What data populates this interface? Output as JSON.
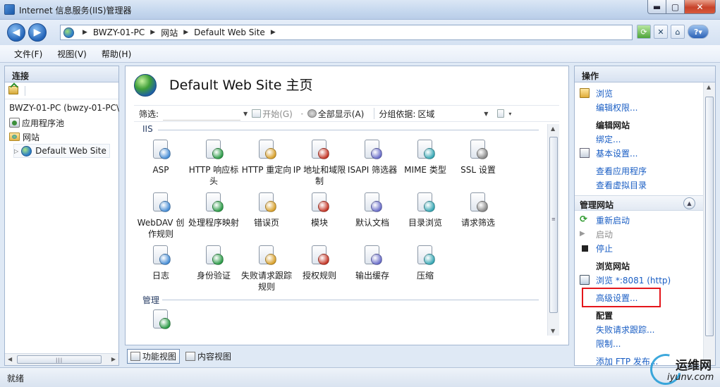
{
  "window": {
    "title": "Internet 信息服务(IIS)管理器",
    "controls": {
      "minimize": "▬",
      "maximize": "▢",
      "close": "✕"
    }
  },
  "address_bar": {
    "crumbs": [
      "BWZY-01-PC",
      "网站",
      "Default Web Site"
    ],
    "separator": "▶"
  },
  "menu": [
    "文件(F)",
    "视图(V)",
    "帮助(H)"
  ],
  "connections": {
    "header": "连接",
    "tree": {
      "root": "BWZY-01-PC (bwzy-01-PC\\",
      "app_pools": "应用程序池",
      "sites": "网站",
      "site": "Default Web Site"
    }
  },
  "center": {
    "title": "Default Web Site 主页",
    "filter": {
      "label": "筛选:",
      "value": "",
      "go_label": "开始(G)",
      "show_all_label": "全部显示(A)",
      "group_label": "分组依据:",
      "group_value": "区域"
    },
    "groups": [
      {
        "name": "IIS",
        "features": [
          {
            "label": "ASP",
            "icon": "asp-icon"
          },
          {
            "label": "HTTP 响应标头",
            "icon": "http-response-headers-icon"
          },
          {
            "label": "HTTP 重定向",
            "icon": "http-redirect-icon"
          },
          {
            "label": "IP 地址和域限制",
            "icon": "ip-domain-restrictions-icon"
          },
          {
            "label": "ISAPI 筛选器",
            "icon": "isapi-filters-icon"
          },
          {
            "label": "MIME 类型",
            "icon": "mime-types-icon"
          },
          {
            "label": "SSL 设置",
            "icon": "ssl-settings-icon"
          },
          {
            "label": "WebDAV 创作规则",
            "icon": "webdav-icon"
          },
          {
            "label": "处理程序映射",
            "icon": "handler-mappings-icon"
          },
          {
            "label": "错误页",
            "icon": "error-pages-icon"
          },
          {
            "label": "模块",
            "icon": "modules-icon"
          },
          {
            "label": "默认文档",
            "icon": "default-document-icon"
          },
          {
            "label": "目录浏览",
            "icon": "directory-browsing-icon"
          },
          {
            "label": "请求筛选",
            "icon": "request-filtering-icon"
          },
          {
            "label": "日志",
            "icon": "logging-icon"
          },
          {
            "label": "身份验证",
            "icon": "authentication-icon"
          },
          {
            "label": "失败请求跟踪规则",
            "icon": "failed-request-tracing-icon"
          },
          {
            "label": "授权规则",
            "icon": "authorization-rules-icon"
          },
          {
            "label": "输出缓存",
            "icon": "output-caching-icon"
          },
          {
            "label": "压缩",
            "icon": "compression-icon"
          }
        ]
      },
      {
        "name": "管理",
        "features": [
          {
            "label": "",
            "icon": "configuration-editor-icon"
          }
        ]
      }
    ],
    "view_tabs": {
      "features": "功能视图",
      "content": "内容视图"
    }
  },
  "actions": {
    "header": "操作",
    "explore": "浏览",
    "edit_permissions": "编辑权限...",
    "edit_site_header": "编辑网站",
    "bindings": "绑定...",
    "basic_settings": "基本设置...",
    "view_applications": "查看应用程序",
    "view_virtual_dirs": "查看虚拟目录",
    "manage_site_header": "管理网站",
    "restart": "重新启动",
    "start": "启动",
    "stop": "停止",
    "browse_site_header": "浏览网站",
    "browse_link": "浏览 *:8081 (http)",
    "advanced_settings": "高级设置...",
    "configure_header": "配置",
    "failed_request_tracing": "失败请求跟踪...",
    "limits": "限制...",
    "add_ftp": "添加 FTP 发布..."
  },
  "status": {
    "text": "就绪"
  },
  "watermark": {
    "cn": "运维网",
    "en": "iyunv.com"
  },
  "colors": {
    "link": "#1a5ec4",
    "highlight": "#e4161b",
    "pane_border": "#a3b6d0"
  }
}
